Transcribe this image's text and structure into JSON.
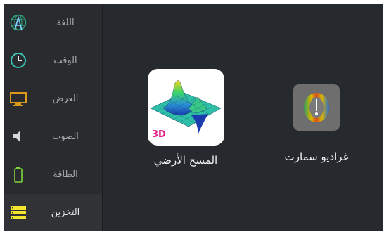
{
  "sidebar": {
    "items": [
      {
        "label": "اللغة",
        "icon": "globe-antenna-icon"
      },
      {
        "label": "الوقت",
        "icon": "clock-icon"
      },
      {
        "label": "العرض",
        "icon": "monitor-icon"
      },
      {
        "label": "الصوت",
        "icon": "speaker-icon"
      },
      {
        "label": "الطاقة",
        "icon": "battery-icon"
      },
      {
        "label": "التخزين",
        "icon": "storage-icon",
        "active": true
      }
    ]
  },
  "apps": [
    {
      "name": "المسح الأرضي",
      "icon": "3d-ground-scan-icon",
      "badge": "3D"
    },
    {
      "name": "غراديو سمارت",
      "icon": "gradio-smart-icon"
    }
  ],
  "colors": {
    "background": "#26292d",
    "active_item": "#303236",
    "globe": "#2fa37a",
    "clock": "#39c6b6",
    "monitor": "#d99a1c",
    "battery": "#7fd63a",
    "storage": "#f2e62e"
  }
}
